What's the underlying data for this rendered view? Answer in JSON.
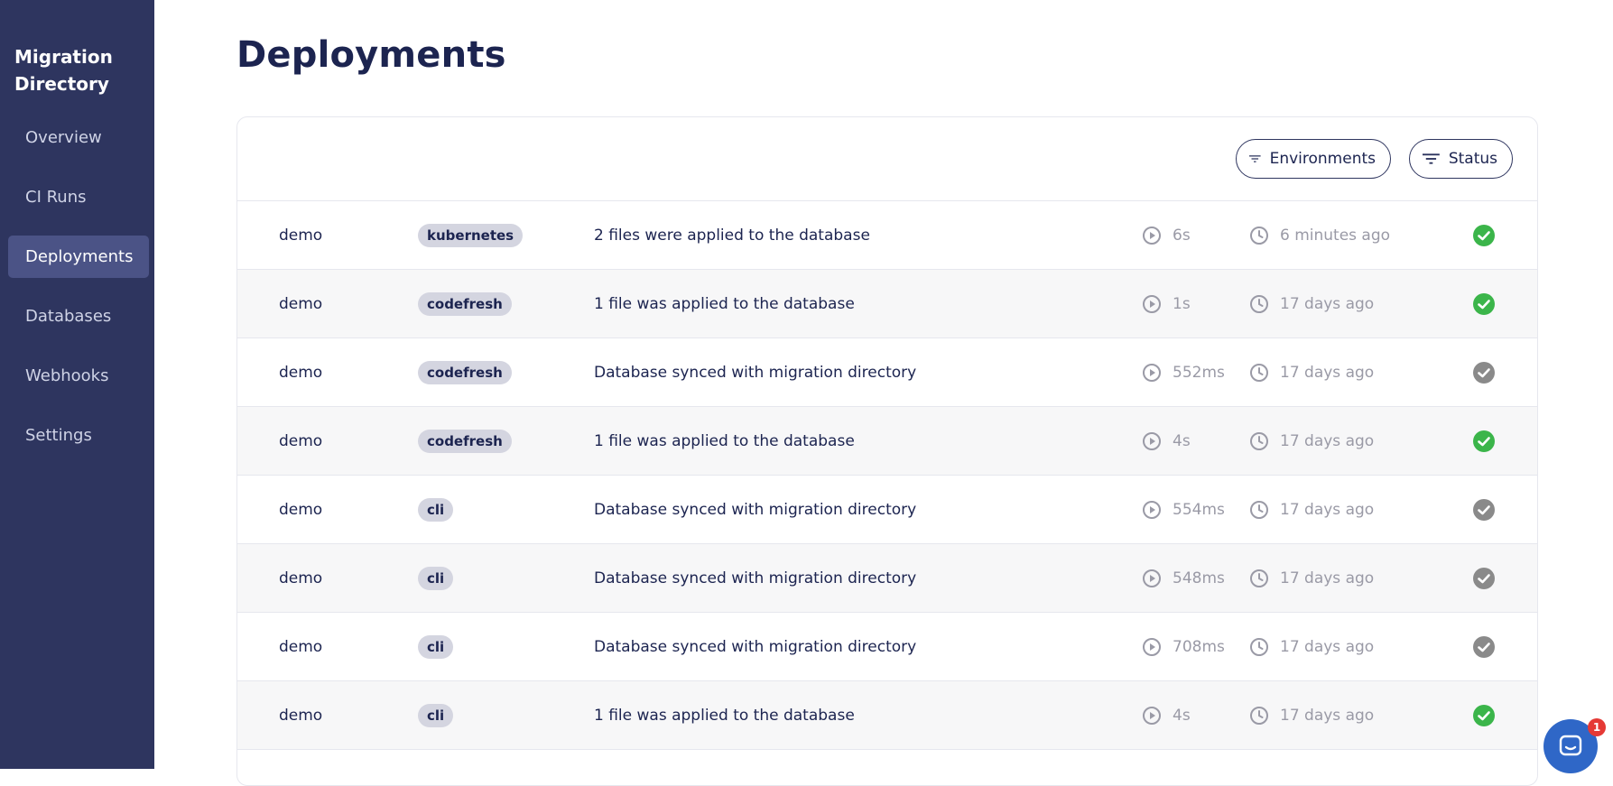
{
  "sidebar": {
    "brand_line1": "Migration",
    "brand_line2": "Directory",
    "items": [
      {
        "label": "Overview"
      },
      {
        "label": "CI Runs"
      },
      {
        "label": "Deployments"
      },
      {
        "label": "Databases"
      },
      {
        "label": "Webhooks"
      },
      {
        "label": "Settings"
      }
    ]
  },
  "page": {
    "title": "Deployments"
  },
  "filters": {
    "environments": "Environments",
    "status": "Status"
  },
  "rows": [
    {
      "name": "demo",
      "tag": "kubernetes",
      "description": "2 files were applied to the database",
      "duration": "6s",
      "time": "6 minutes ago",
      "status": "success"
    },
    {
      "name": "demo",
      "tag": "codefresh",
      "description": "1 file was applied to the database",
      "duration": "1s",
      "time": "17 days ago",
      "status": "success"
    },
    {
      "name": "demo",
      "tag": "codefresh",
      "description": "Database synced with migration directory",
      "duration": "552ms",
      "time": "17 days ago",
      "status": "synced"
    },
    {
      "name": "demo",
      "tag": "codefresh",
      "description": "1 file was applied to the database",
      "duration": "4s",
      "time": "17 days ago",
      "status": "success"
    },
    {
      "name": "demo",
      "tag": "cli",
      "description": "Database synced with migration directory",
      "duration": "554ms",
      "time": "17 days ago",
      "status": "synced"
    },
    {
      "name": "demo",
      "tag": "cli",
      "description": "Database synced with migration directory",
      "duration": "548ms",
      "time": "17 days ago",
      "status": "synced"
    },
    {
      "name": "demo",
      "tag": "cli",
      "description": "Database synced with migration directory",
      "duration": "708ms",
      "time": "17 days ago",
      "status": "synced"
    },
    {
      "name": "demo",
      "tag": "cli",
      "description": "1 file was applied to the database",
      "duration": "4s",
      "time": "17 days ago",
      "status": "success"
    }
  ],
  "chat": {
    "badge": "1"
  },
  "colors": {
    "sidebar": "#2e355f",
    "active": "#4b5386",
    "success": "#3bb54a",
    "synced": "#8a8a8a",
    "text": "#1c2450"
  },
  "icons": {
    "duration": "play-circle-icon",
    "time": "clock-icon",
    "filter": "filter-icon",
    "status": "check-circle-icon",
    "chat": "chat-icon"
  }
}
